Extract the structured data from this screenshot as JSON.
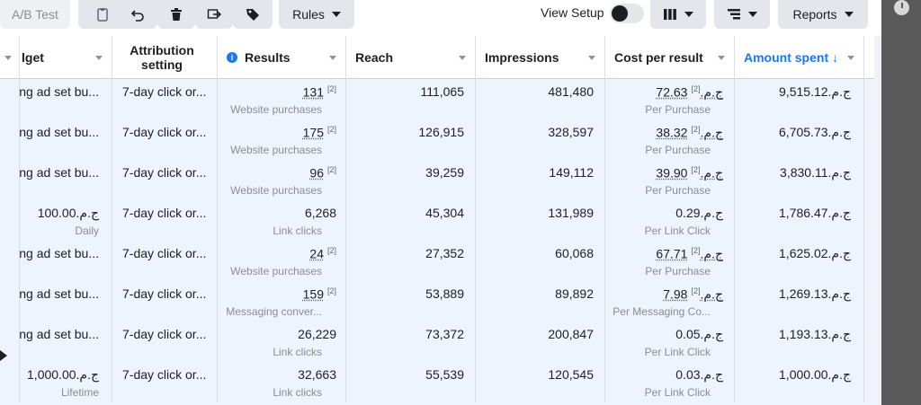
{
  "toolbar": {
    "ab_test_label": "A/B Test",
    "rules_label": "Rules",
    "view_setup_label": "View Setup",
    "reports_label": "Reports"
  },
  "columns": {
    "budget": "lget",
    "attribution": "Attribution setting",
    "results": "Results",
    "reach": "Reach",
    "impressions": "Impressions",
    "cost_per_result": "Cost per result",
    "amount_spent": "Amount spent ↓"
  },
  "footnote": "[2]",
  "rows": [
    {
      "budget": "ng ad set bu...",
      "budget_sub": "",
      "attribution": "7-day click or...",
      "results": "131",
      "results_fn": true,
      "results_sub": "Website purchases",
      "reach": "111,065",
      "impressions": "481,480",
      "cost": "72.63ج.م.‏",
      "cost_fn": true,
      "cost_sub": "Per Purchase",
      "spent": "9,515.12ج.م.‏"
    },
    {
      "budget": "ng ad set bu...",
      "budget_sub": "",
      "attribution": "7-day click or...",
      "results": "175",
      "results_fn": true,
      "results_sub": "Website purchases",
      "reach": "126,915",
      "impressions": "328,597",
      "cost": "38.32ج.م.‏",
      "cost_fn": true,
      "cost_sub": "Per Purchase",
      "spent": "6,705.73ج.م.‏"
    },
    {
      "budget": "ng ad set bu...",
      "budget_sub": "",
      "attribution": "7-day click or...",
      "results": "96",
      "results_fn": true,
      "results_sub": "Website purchases",
      "reach": "39,259",
      "impressions": "149,112",
      "cost": "39.90ج.م.‏",
      "cost_fn": true,
      "cost_sub": "Per Purchase",
      "spent": "3,830.11ج.م.‏"
    },
    {
      "budget": "100.00ج.م.‏",
      "budget_sub": "Daily",
      "attribution": "7-day click or...",
      "results": "6,268",
      "results_fn": false,
      "results_sub": "Link clicks",
      "reach": "45,304",
      "impressions": "131,989",
      "cost": "0.29ج.م.‏",
      "cost_fn": false,
      "cost_sub": "Per Link Click",
      "spent": "1,786.47ج.م.‏"
    },
    {
      "budget": "ng ad set bu...",
      "budget_sub": "",
      "attribution": "7-day click or...",
      "results": "24",
      "results_fn": true,
      "results_sub": "Website purchases",
      "reach": "27,352",
      "impressions": "60,068",
      "cost": "67.71ج.م.‏",
      "cost_fn": true,
      "cost_sub": "Per Purchase",
      "spent": "1,625.02ج.م.‏"
    },
    {
      "budget": "ng ad set bu...",
      "budget_sub": "",
      "attribution": "7-day click or...",
      "results": "159",
      "results_fn": true,
      "results_sub": "Messaging conver...",
      "reach": "53,889",
      "impressions": "89,892",
      "cost": "7.98ج.م.‏",
      "cost_fn": true,
      "cost_sub": "Per Messaging Co...",
      "spent": "1,269.13ج.م.‏"
    },
    {
      "budget": "ng ad set bu...",
      "budget_sub": "",
      "attribution": "7-day click or...",
      "results": "26,229",
      "results_fn": false,
      "results_sub": "Link clicks",
      "reach": "73,372",
      "impressions": "200,847",
      "cost": "0.05ج.م.‏",
      "cost_fn": false,
      "cost_sub": "Per Link Click",
      "spent": "1,193.13ج.م.‏"
    },
    {
      "budget": "1,000.00ج.م.‏",
      "budget_sub": "Lifetime",
      "attribution": "7-day click or...",
      "results": "32,663",
      "results_fn": false,
      "results_sub": "Link clicks",
      "reach": "55,539",
      "impressions": "120,545",
      "cost": "0.03ج.م.‏",
      "cost_fn": false,
      "cost_sub": "Per Link Click",
      "spent": "1,000.00ج.م.‏"
    }
  ],
  "colors": {
    "accent": "#1877f2",
    "row_bg": "#eef4fd"
  }
}
